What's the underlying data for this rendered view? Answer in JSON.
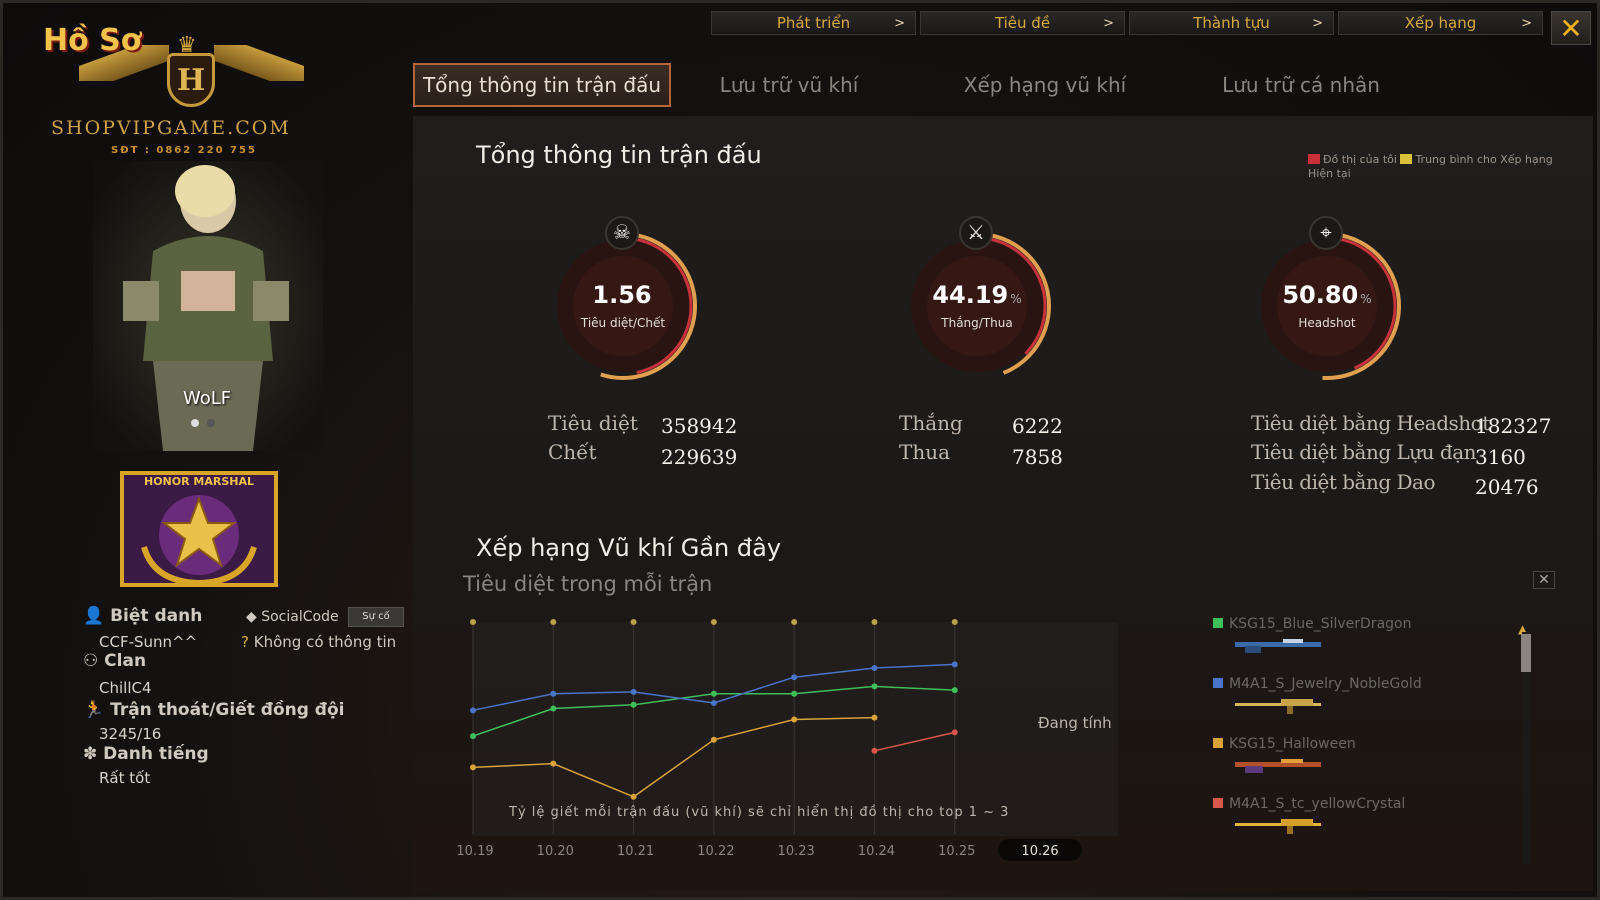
{
  "logo": {
    "title": "Hồ Sơ",
    "shield_letter": "H",
    "site": "SHOPVIPGAME.COM",
    "phone": "SĐT : 0862 220 755"
  },
  "top_nav": [
    {
      "label": "Phát triển"
    },
    {
      "label": "Tiêu đề"
    },
    {
      "label": "Thành tựu"
    },
    {
      "label": "Xếp hạng"
    }
  ],
  "close_label": "✕",
  "tabs": [
    {
      "label": "Tổng thông tin trận đấu"
    },
    {
      "label": "Lưu trữ vũ khí"
    },
    {
      "label": "Xếp hạng vũ khí"
    },
    {
      "label": "Lưu trữ cá nhân"
    }
  ],
  "summary": {
    "title": "Tổng thông tin trận đấu",
    "legend": {
      "mine": "Đồ thị của tôi",
      "avg": "Trung bình cho Xếp hạng Hiện tại",
      "mine_color": "#c8313a",
      "avg_color": "#d9c23a"
    },
    "gauges": [
      {
        "value": "1.56",
        "unit": "",
        "label": "Tiêu diệt/Chết",
        "fill": 0.55,
        "icon": "skull-icon"
      },
      {
        "value": "44.19",
        "unit": "%",
        "label": "Thắng/Thua",
        "fill": 0.44,
        "icon": "crossed-swords-icon"
      },
      {
        "value": "50.80",
        "unit": "%",
        "label": "Headshot",
        "fill": 0.51,
        "icon": "crosshair-icon"
      }
    ],
    "stats": {
      "kills_label": "Tiêu diệt",
      "kills": "358942",
      "deaths_label": "Chết",
      "deaths": "229639",
      "wins_label": "Thắng",
      "wins": "6222",
      "losses_label": "Thua",
      "losses": "7858",
      "hs_kills_label": "Tiêu diệt bằng Headshot",
      "hs_kills": "182327",
      "grenade_kills_label": "Tiêu diệt bằng Lựu đạn",
      "grenade_kills": "3160",
      "knife_kills_label": "Tiêu diệt bằng Dao",
      "knife_kills": "20476"
    }
  },
  "recent": {
    "title": "Xếp hạng Vũ khí Gần đây",
    "subtitle": "Tiêu diệt trong mỗi trận",
    "footnote": "Tỷ lệ giết mỗi trận đấu (vũ khí) sẽ chỉ hiển thị đồ thị cho top 1 ~ 3",
    "pending": "Đang tính",
    "weapons": [
      {
        "name": "KSG15_Blue_SilverDragon",
        "color": "#3fbf5a",
        "gun": "shotgun-blue-icon"
      },
      {
        "name": "M4A1_S_Jewelry_NobleGold",
        "color": "#4a74c8",
        "gun": "rifle-gold-icon"
      },
      {
        "name": "KSG15_Halloween",
        "color": "#d9a33a",
        "gun": "shotgun-halloween-icon"
      },
      {
        "name": "M4A1_S_tc_yellowCrystal",
        "color": "#d9574a",
        "gun": "rifle-crystal-icon"
      }
    ]
  },
  "profile": {
    "nickname": "WoLF",
    "rank": "HONOR MARSHAL",
    "alias_label": "Biệt danh",
    "alias": "CCF-Sunn^^",
    "socialcode_label": "SocialCode",
    "socialcode_btn": "Sự cố",
    "socialcode_value": "Không có thông tin",
    "clan_label": "Clan",
    "clan": "ChillC4",
    "leave_label": "Trận thoát/Giết đồng đội",
    "leave": "3245/16",
    "reputation_label": "Danh tiếng",
    "reputation": "Rất tốt"
  },
  "chart_data": {
    "type": "line",
    "title": "Tiêu diệt trong mỗi trận",
    "categories": [
      "10.19",
      "10.20",
      "10.21",
      "10.22",
      "10.23",
      "10.24",
      "10.25",
      "10.26"
    ],
    "highlight_category": "10.26",
    "ylim": [
      0,
      100
    ],
    "grid": true,
    "series": [
      {
        "name": "KSG15_Blue_SilverDragon",
        "color": "#3fbf5a",
        "values": [
          38,
          53,
          55,
          61,
          61,
          65,
          63,
          null
        ]
      },
      {
        "name": "M4A1_S_Jewelry_NobleGold",
        "color": "#4a74c8",
        "values": [
          52,
          61,
          62,
          56,
          70,
          75,
          77,
          null
        ]
      },
      {
        "name": "KSG15_Halloween",
        "color": "#d9a33a",
        "values": [
          21,
          23,
          5,
          36,
          47,
          48,
          null,
          null
        ]
      },
      {
        "name": "M4A1_S_tc_yellowCrystal",
        "color": "#d9574a",
        "values": [
          null,
          null,
          null,
          null,
          null,
          30,
          40,
          null
        ]
      }
    ]
  }
}
